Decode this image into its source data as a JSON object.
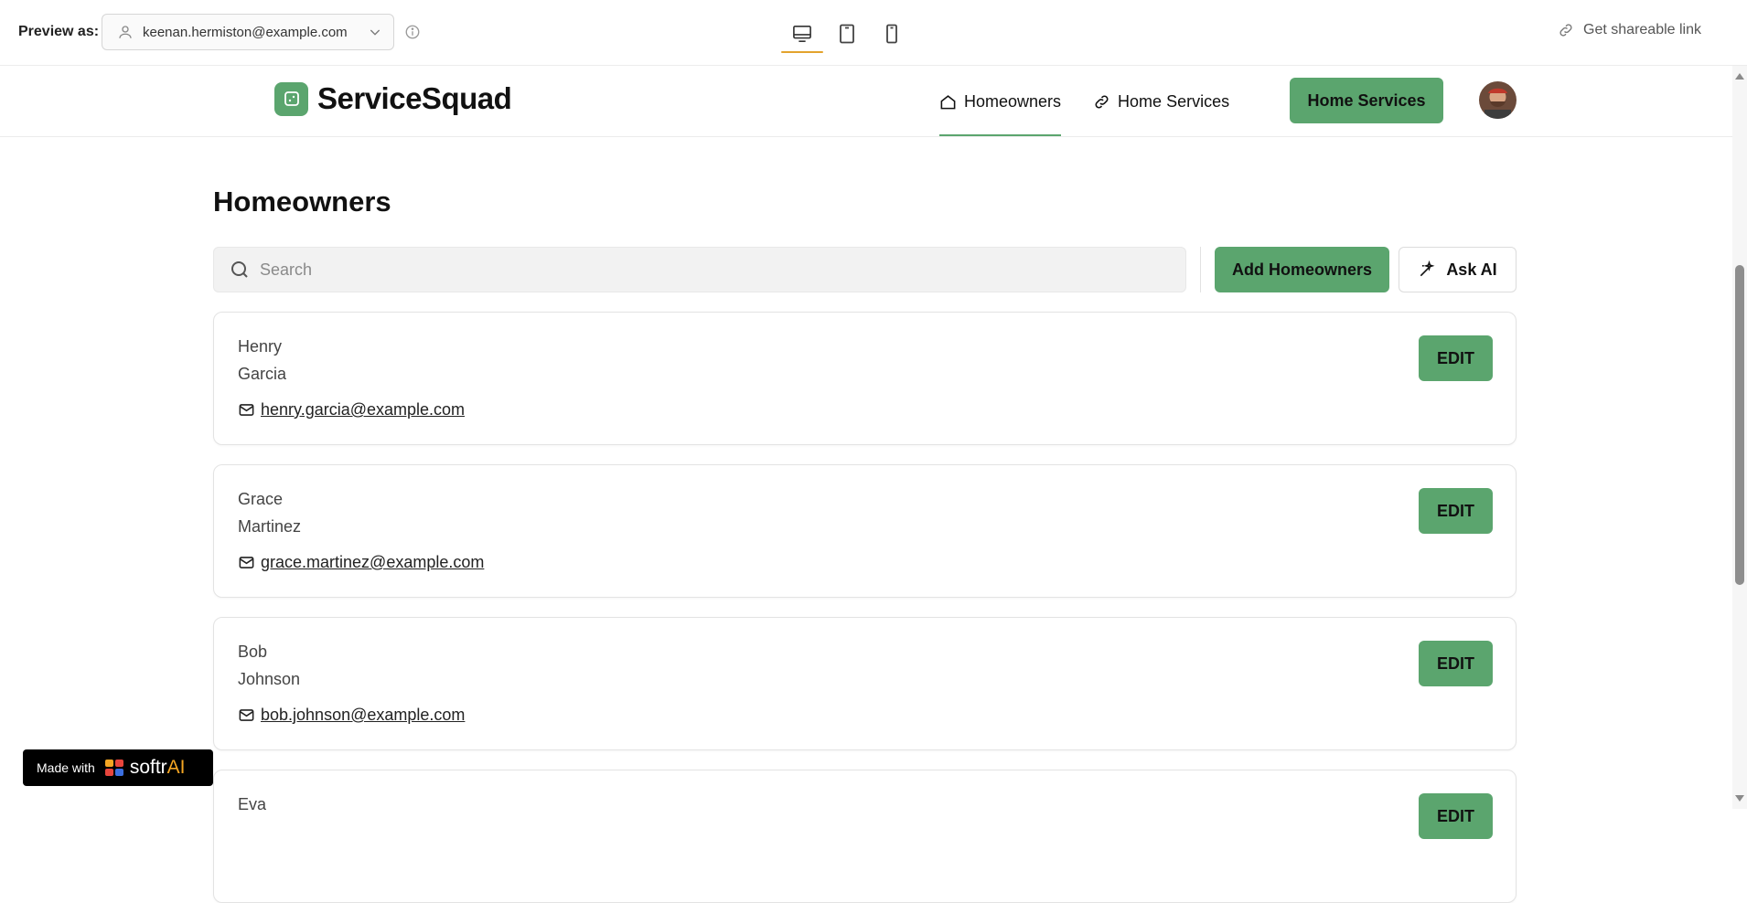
{
  "preview": {
    "label": "Preview as:",
    "user": "keenan.hermiston@example.com",
    "share_label": "Get shareable link",
    "devices": [
      "desktop-icon",
      "tablet-icon",
      "mobile-icon"
    ],
    "active_device": "desktop"
  },
  "header": {
    "brand": "ServiceSquad",
    "nav": [
      {
        "label": "Homeowners",
        "icon": "home-icon",
        "active": true
      },
      {
        "label": "Home Services",
        "icon": "link-icon",
        "active": false
      }
    ],
    "cta_label": "Home Services"
  },
  "main": {
    "title": "Homeowners",
    "search_placeholder": "Search",
    "add_label": "Add Homeowners",
    "ai_label": "Ask AI",
    "edit_label": "EDIT",
    "homeowners": [
      {
        "first": "Henry",
        "last": "Garcia",
        "email": "henry.garcia@example.com"
      },
      {
        "first": "Grace",
        "last": "Martinez",
        "email": "grace.martinez@example.com"
      },
      {
        "first": "Bob",
        "last": "Johnson",
        "email": "bob.johnson@example.com"
      },
      {
        "first": "Eva",
        "last": "",
        "email": ""
      }
    ]
  },
  "badge": {
    "prefix": "Made with",
    "brand": "softr",
    "brand_suffix": "AI"
  },
  "colors": {
    "accent": "#5ba56e",
    "device_active": "#e3a32d"
  }
}
